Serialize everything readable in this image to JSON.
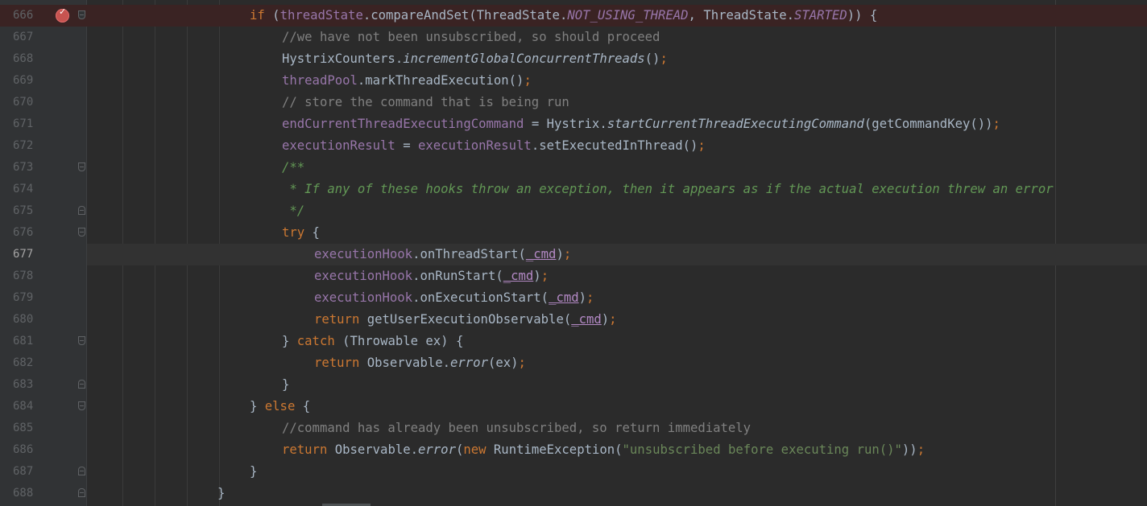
{
  "editor": {
    "line_numbers": [
      "666",
      "667",
      "668",
      "669",
      "670",
      "671",
      "672",
      "673",
      "674",
      "675",
      "676",
      "677",
      "678",
      "679",
      "680",
      "681",
      "682",
      "683",
      "684",
      "685",
      "686",
      "687",
      "688"
    ],
    "lines": {
      "l666": {
        "a": "if",
        "b": " (",
        "c": "threadState",
        "d": ".compareAndSet(ThreadState.",
        "e": "NOT_USING_THREAD",
        "f": ", ThreadState.",
        "g": "STARTED",
        "h": ")) {"
      },
      "l667": {
        "a": "//we have not been unsubscribed, so should proceed"
      },
      "l668": {
        "a": "HystrixCounters.",
        "b": "incrementGlobalConcurrentThreads",
        "c": "()",
        ";": ";"
      },
      "l669": {
        "a": "threadPool",
        "b": ".markThreadExecution()",
        "c": ";"
      },
      "l670": {
        "a": "// store the command that is being run"
      },
      "l671": {
        "a": "endCurrentThreadExecutingCommand",
        "b": " = Hystrix.",
        "c": "startCurrentThreadExecutingCommand",
        "d": "(getCommandKey())",
        "e": ";"
      },
      "l672": {
        "a": "executionResult",
        "b": " = ",
        "c": "executionResult",
        "d": ".setExecutedInThread()",
        "e": ";"
      },
      "l673": {
        "a": "/**"
      },
      "l674": {
        "a": " * If any of these hooks throw an exception, then it appears as if the actual execution threw an error"
      },
      "l675": {
        "a": " */"
      },
      "l676": {
        "a": "try",
        "b": " {"
      },
      "l677": {
        "a": "executionHook",
        "b": ".onThreadStart(",
        "c": "_cmd",
        "d": ")",
        "e": ";"
      },
      "l678": {
        "a": "executionHook",
        "b": ".onRunStart(",
        "c": "_cmd",
        "d": ")",
        "e": ";"
      },
      "l679": {
        "a": "executionHook",
        "b": ".onExecutionStart(",
        "c": "_cmd",
        "d": ")",
        "e": ";"
      },
      "l680": {
        "a": "return",
        "b": " getUserExecutionObservable(",
        "c": "_cmd",
        "d": ")",
        "e": ";"
      },
      "l681": {
        "a": "} ",
        "b": "catch",
        "c": " (Throwable ex) {"
      },
      "l682": {
        "a": "return",
        "b": " Observable.",
        "c": "error",
        "d": "(ex)",
        "e": ";"
      },
      "l683": {
        "a": "}"
      },
      "l684": {
        "a": "} ",
        "b": "else",
        "c": " {"
      },
      "l685": {
        "a": "//command has already been unsubscribed, so return immediately"
      },
      "l686": {
        "a": "return",
        "b": " Observable.",
        "c": "error",
        "d": "(",
        "e": "new",
        "f": " RuntimeException(",
        "g": "\"unsubscribed before executing run()\"",
        "h": "))",
        "i": ";"
      },
      "l687": {
        "a": "}"
      },
      "l688": {
        "a": "}"
      }
    }
  },
  "colors": {
    "background": "#2b2b2b",
    "gutter": "#313335",
    "keyword": "#cc7832",
    "field": "#9876aa",
    "method_decl": "#ffc66d",
    "comment": "#808080",
    "doc_comment": "#629755",
    "string": "#6a8759",
    "breakpoint_line": "#3a2323",
    "caret_line": "#323232"
  },
  "icons": {
    "breakpoint": "breakpoint-icon",
    "fold": "fold-marker-icon"
  }
}
